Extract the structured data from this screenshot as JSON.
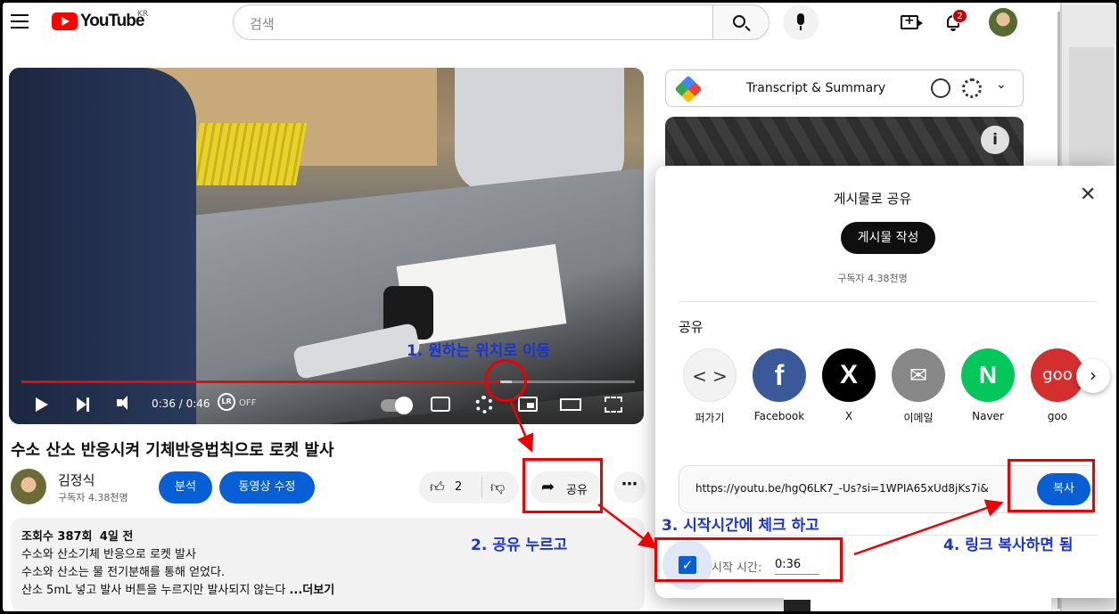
{
  "header": {
    "logo_text": "YouTube",
    "region": "KR",
    "search_placeholder": "검색",
    "notification_count": "2"
  },
  "video": {
    "time": "0:36 / 0:46",
    "progress_fraction": 0.78,
    "lr_label": "LR",
    "lr_status": "OFF"
  },
  "title": "수소 산소 반응시켜 기체반응법칙으로 로켓 발사",
  "channel": {
    "name": "김정식",
    "subscribers": "구독자 4.38천명"
  },
  "actions": {
    "analytics": "분석",
    "edit_video": "동영상 수정",
    "like_count": "2",
    "share": "공유",
    "more": "⋯"
  },
  "description": {
    "views": "조회수 387회",
    "date": "4일 전",
    "lines": [
      "수소와 산소기체 반응으로 로켓 발사",
      "수소와 산소는 물 전기분해를 통해 얻었다.",
      "산소 5mL 넣고 발사 버튼을 누르지만 발사되지 않는다"
    ],
    "more": "...더보기"
  },
  "sidebar": {
    "transcript_label": "Transcript & Summary"
  },
  "share_dialog": {
    "title": "게시물로 공유",
    "post_button": "게시물 작성",
    "subscribers": "구독자 4.38천명",
    "share_heading": "공유",
    "targets": [
      {
        "label": "퍼가기",
        "icon": "embed-icon",
        "color": "#f2f2f2"
      },
      {
        "label": "Facebook",
        "icon": "facebook-icon",
        "color": "#3b5998"
      },
      {
        "label": "X",
        "icon": "x-icon",
        "color": "#000000"
      },
      {
        "label": "이메일",
        "icon": "email-icon",
        "color": "#888888"
      },
      {
        "label": "Naver",
        "icon": "naver-icon",
        "color": "#03c75a"
      },
      {
        "label": "goo",
        "icon": "goo-icon",
        "color": "#d32f2f"
      }
    ],
    "url": "https://youtu.be/hgQ6LK7_-Us?si=1WPIA65xUd8jKs7i&",
    "copy_button": "복사",
    "start_time_label": "시작 시간:",
    "start_time_value": "0:36",
    "start_time_checked": true
  },
  "annotations": {
    "step1": "1. 원하는 위치로 이동",
    "step2": "2. 공유 누르고",
    "step3": "3. 시작시간에 체크 하고",
    "step4": "4. 링크 복사하면 됨",
    "color": "#1a35d1",
    "box_color": "#ee0000"
  }
}
